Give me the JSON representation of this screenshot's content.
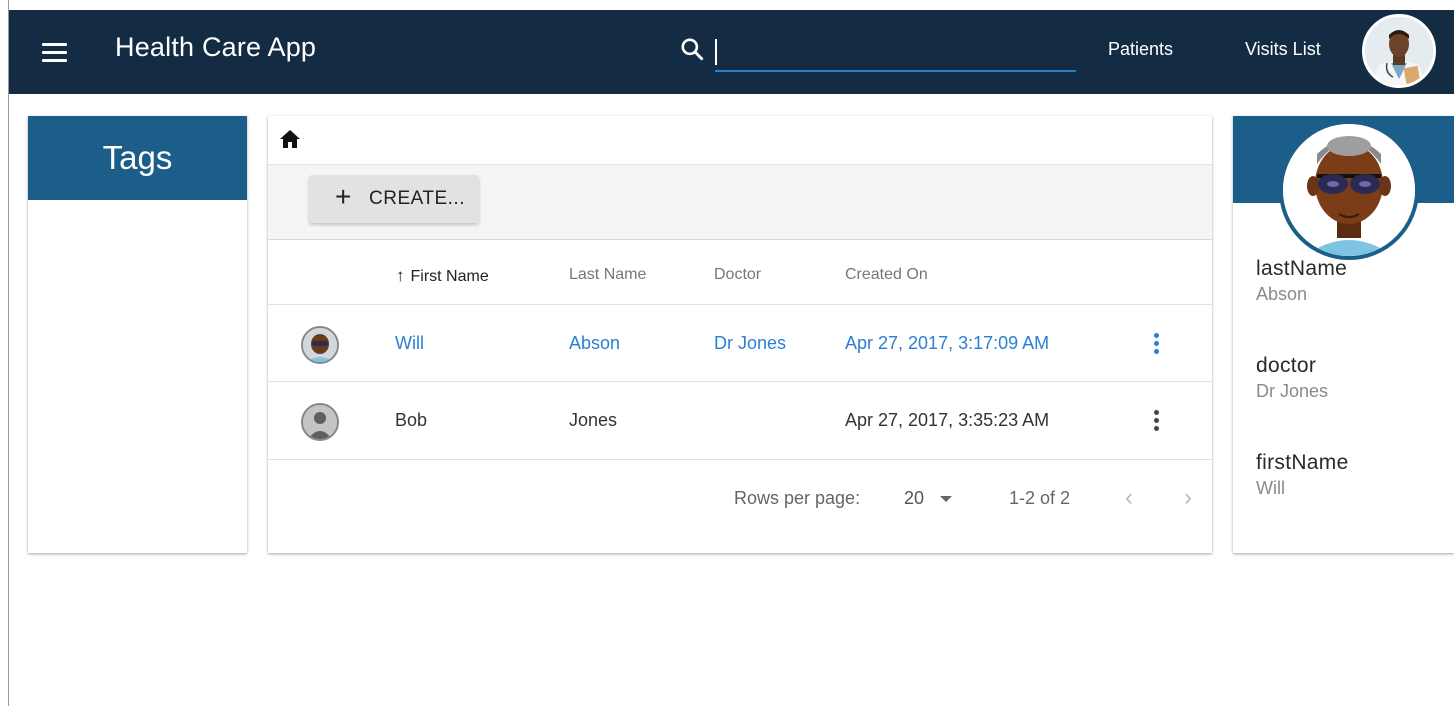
{
  "app": {
    "title": "Health Care App"
  },
  "header": {
    "search": {
      "value": "",
      "placeholder": ""
    },
    "nav": [
      "Patients",
      "Visits List"
    ]
  },
  "tags": {
    "title": "Tags"
  },
  "toolbar": {
    "create_label": "CREATE..."
  },
  "table": {
    "columns": [
      "First Name",
      "Last Name",
      "Doctor",
      "Created On"
    ],
    "sort": {
      "column": "First Name",
      "direction": "ascending"
    },
    "rows": [
      {
        "first_name": "Will",
        "last_name": "Abson",
        "doctor": "Dr Jones",
        "created_on": "Apr 27, 2017, 3:17:09 AM",
        "selected": true
      },
      {
        "first_name": "Bob",
        "last_name": "Jones",
        "doctor": "",
        "created_on": "Apr 27, 2017, 3:35:23 AM",
        "selected": false
      }
    ]
  },
  "pagination": {
    "rows_per_page_label": "Rows per page:",
    "rows_per_page": "20",
    "range": "1-2 of 2"
  },
  "detail": {
    "fields": [
      {
        "label": "lastName",
        "value": "Abson"
      },
      {
        "label": "doctor",
        "value": "Dr Jones"
      },
      {
        "label": "firstName",
        "value": "Will"
      }
    ]
  },
  "colors": {
    "appbar": "#132c43",
    "panel_header": "#1b5e8a",
    "link": "#2b7fd5",
    "search_underline": "#2b80c5"
  }
}
